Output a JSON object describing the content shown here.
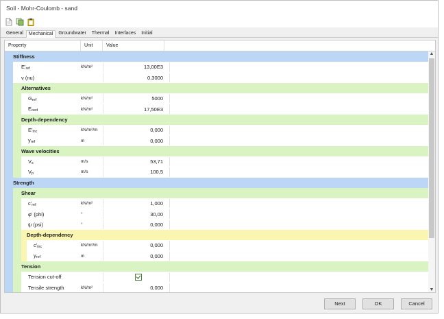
{
  "window": {
    "title": "Soil - Mohr-Coulomb - sand"
  },
  "toolbar": {
    "icons": [
      "document-icon",
      "copy-sheet-icon",
      "clipboard-icon"
    ]
  },
  "tabs": [
    "General",
    "Mechanical",
    "Groundwater",
    "Thermal",
    "Interfaces",
    "Initial"
  ],
  "active_tab": "Mechanical",
  "grid": {
    "headers": {
      "property": "Property",
      "unit": "Unit",
      "value": "Value"
    },
    "rows": [
      {
        "kind": "sec1",
        "label": "Stiffness"
      },
      {
        "kind": "data",
        "depth": 1,
        "label": "E'",
        "sub": "ref",
        "unit": "kN/m²",
        "value": "13,00E3"
      },
      {
        "kind": "data",
        "depth": 1,
        "label": "ν (nu)",
        "sub": "",
        "unit": "",
        "value": "0,3000"
      },
      {
        "kind": "sec2",
        "label": "Alternatives"
      },
      {
        "kind": "data",
        "depth": 2,
        "label": "G",
        "sub": "ref",
        "unit": "kN/m²",
        "value": "5000"
      },
      {
        "kind": "data",
        "depth": 2,
        "label": "E",
        "sub": "oed",
        "unit": "kN/m²",
        "value": "17,50E3"
      },
      {
        "kind": "sec2",
        "label": "Depth-dependency"
      },
      {
        "kind": "data",
        "depth": 2,
        "label": "E'",
        "sub": "inc",
        "unit": "kN/m²/m",
        "value": "0,000"
      },
      {
        "kind": "data",
        "depth": 2,
        "label": "y",
        "sub": "ref",
        "unit": "m",
        "value": "0,000"
      },
      {
        "kind": "sec2",
        "label": "Wave velocities"
      },
      {
        "kind": "data",
        "depth": 2,
        "label": "V",
        "sub": "s",
        "unit": "m/s",
        "value": "53,71"
      },
      {
        "kind": "data",
        "depth": 2,
        "label": "V",
        "sub": "p",
        "unit": "m/s",
        "value": "100,5"
      },
      {
        "kind": "sec1",
        "label": "Strength"
      },
      {
        "kind": "sec2",
        "label": "Shear"
      },
      {
        "kind": "data",
        "depth": 2,
        "label": "c'",
        "sub": "ref",
        "unit": "kN/m²",
        "value": "1,000"
      },
      {
        "kind": "data",
        "depth": 2,
        "label": "φ' (phi)",
        "sub": "",
        "unit": "°",
        "value": "30,00"
      },
      {
        "kind": "data",
        "depth": 2,
        "label": "ψ (psi)",
        "sub": "",
        "unit": "°",
        "value": "0,000"
      },
      {
        "kind": "sec3",
        "label": "Depth-dependency"
      },
      {
        "kind": "data",
        "depth": 3,
        "label": "c'",
        "sub": "inc",
        "unit": "kN/m²/m",
        "value": "0,000"
      },
      {
        "kind": "data",
        "depth": 3,
        "label": "y",
        "sub": "ref",
        "unit": "m",
        "value": "0,000"
      },
      {
        "kind": "sec2",
        "label": "Tension"
      },
      {
        "kind": "check",
        "depth": 2,
        "label": "Tension cut-off",
        "unit": "",
        "value": "",
        "checked": true
      },
      {
        "kind": "data",
        "depth": 2,
        "label": "Tensile strength",
        "sub": "",
        "unit": "kN/m²",
        "value": "0,000"
      }
    ]
  },
  "buttons": {
    "next": "Next",
    "ok": "OK",
    "cancel": "Cancel"
  },
  "colors": {
    "level1": "#bcd7f5",
    "level2": "#d9f4c2",
    "level3": "#fbf5b2"
  }
}
